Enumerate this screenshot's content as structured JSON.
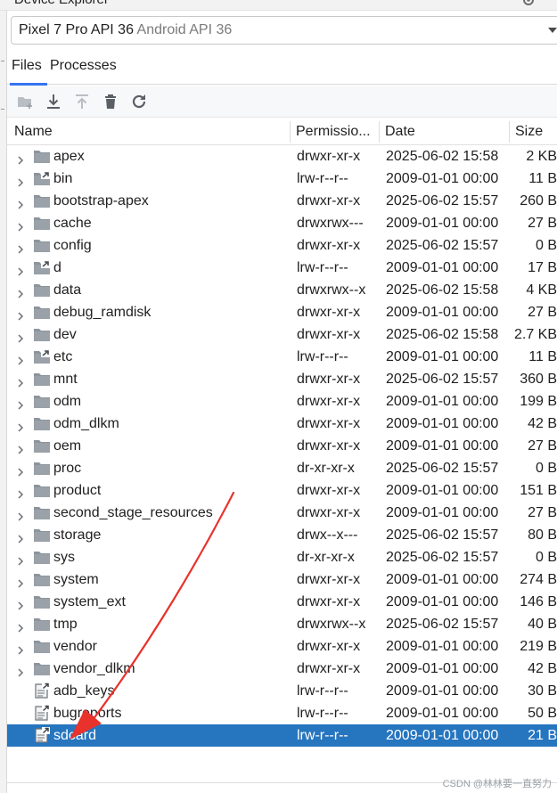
{
  "window": {
    "title": "Device Explorer"
  },
  "device": {
    "name": "Pixel 7 Pro API 36",
    "api": "Android API 36"
  },
  "tabs": [
    {
      "label": "Files",
      "active": true
    },
    {
      "label": "Processes",
      "active": false
    }
  ],
  "toolbar": [
    {
      "icon": "new-folder-icon",
      "enabled": false
    },
    {
      "icon": "download-icon",
      "enabled": true
    },
    {
      "icon": "upload-icon",
      "enabled": false
    },
    {
      "icon": "delete-icon",
      "enabled": true
    },
    {
      "icon": "refresh-icon",
      "enabled": true
    }
  ],
  "columns": {
    "name": "Name",
    "permissions": "Permissio...",
    "date": "Date",
    "size": "Size"
  },
  "rows": [
    {
      "name": "apex",
      "type": "folder",
      "perm": "drwxr-xr-x",
      "date": "2025-06-02 15:58",
      "size": "2 KB"
    },
    {
      "name": "bin",
      "type": "folder-link",
      "perm": "lrw-r--r--",
      "date": "2009-01-01 00:00",
      "size": "11 B"
    },
    {
      "name": "bootstrap-apex",
      "type": "folder",
      "perm": "drwxr-xr-x",
      "date": "2025-06-02 15:57",
      "size": "260 B"
    },
    {
      "name": "cache",
      "type": "folder",
      "perm": "drwxrwx---",
      "date": "2009-01-01 00:00",
      "size": "27 B"
    },
    {
      "name": "config",
      "type": "folder",
      "perm": "drwxr-xr-x",
      "date": "2025-06-02 15:57",
      "size": "0 B"
    },
    {
      "name": "d",
      "type": "folder-link",
      "perm": "lrw-r--r--",
      "date": "2009-01-01 00:00",
      "size": "17 B"
    },
    {
      "name": "data",
      "type": "folder",
      "perm": "drwxrwx--x",
      "date": "2025-06-02 15:58",
      "size": "4 KB"
    },
    {
      "name": "debug_ramdisk",
      "type": "folder",
      "perm": "drwxr-xr-x",
      "date": "2009-01-01 00:00",
      "size": "27 B"
    },
    {
      "name": "dev",
      "type": "folder",
      "perm": "drwxr-xr-x",
      "date": "2025-06-02 15:58",
      "size": "2.7 KB"
    },
    {
      "name": "etc",
      "type": "folder-link",
      "perm": "lrw-r--r--",
      "date": "2009-01-01 00:00",
      "size": "11 B"
    },
    {
      "name": "mnt",
      "type": "folder",
      "perm": "drwxr-xr-x",
      "date": "2025-06-02 15:57",
      "size": "360 B"
    },
    {
      "name": "odm",
      "type": "folder",
      "perm": "drwxr-xr-x",
      "date": "2009-01-01 00:00",
      "size": "199 B"
    },
    {
      "name": "odm_dlkm",
      "type": "folder",
      "perm": "drwxr-xr-x",
      "date": "2009-01-01 00:00",
      "size": "42 B"
    },
    {
      "name": "oem",
      "type": "folder",
      "perm": "drwxr-xr-x",
      "date": "2009-01-01 00:00",
      "size": "27 B"
    },
    {
      "name": "proc",
      "type": "folder",
      "perm": "dr-xr-xr-x",
      "date": "2025-06-02 15:57",
      "size": "0 B"
    },
    {
      "name": "product",
      "type": "folder",
      "perm": "drwxr-xr-x",
      "date": "2009-01-01 00:00",
      "size": "151 B"
    },
    {
      "name": "second_stage_resources",
      "type": "folder",
      "perm": "drwxr-xr-x",
      "date": "2009-01-01 00:00",
      "size": "27 B"
    },
    {
      "name": "storage",
      "type": "folder",
      "perm": "drwx--x---",
      "date": "2025-06-02 15:57",
      "size": "80 B"
    },
    {
      "name": "sys",
      "type": "folder",
      "perm": "dr-xr-xr-x",
      "date": "2025-06-02 15:57",
      "size": "0 B"
    },
    {
      "name": "system",
      "type": "folder",
      "perm": "drwxr-xr-x",
      "date": "2009-01-01 00:00",
      "size": "274 B"
    },
    {
      "name": "system_ext",
      "type": "folder",
      "perm": "drwxr-xr-x",
      "date": "2009-01-01 00:00",
      "size": "146 B"
    },
    {
      "name": "tmp",
      "type": "folder",
      "perm": "drwxrwx--x",
      "date": "2025-06-02 15:57",
      "size": "40 B"
    },
    {
      "name": "vendor",
      "type": "folder",
      "perm": "drwxr-xr-x",
      "date": "2009-01-01 00:00",
      "size": "219 B"
    },
    {
      "name": "vendor_dlkm",
      "type": "folder",
      "perm": "drwxr-xr-x",
      "date": "2009-01-01 00:00",
      "size": "42 B"
    },
    {
      "name": "adb_keys",
      "type": "file-link",
      "perm": "lrw-r--r--",
      "date": "2009-01-01 00:00",
      "size": "30 B"
    },
    {
      "name": "bugreports",
      "type": "file-link",
      "perm": "lrw-r--r--",
      "date": "2009-01-01 00:00",
      "size": "50 B"
    },
    {
      "name": "sdcard",
      "type": "file-link",
      "perm": "lrw-r--r--",
      "date": "2009-01-01 00:00",
      "size": "21 B",
      "selected": true
    }
  ],
  "watermark": "CSDN @林林要一直努力",
  "colors": {
    "selection": "#2675bf",
    "accent": "#3574f0",
    "annotation": "#e8322b",
    "folder": "#8c949c"
  }
}
